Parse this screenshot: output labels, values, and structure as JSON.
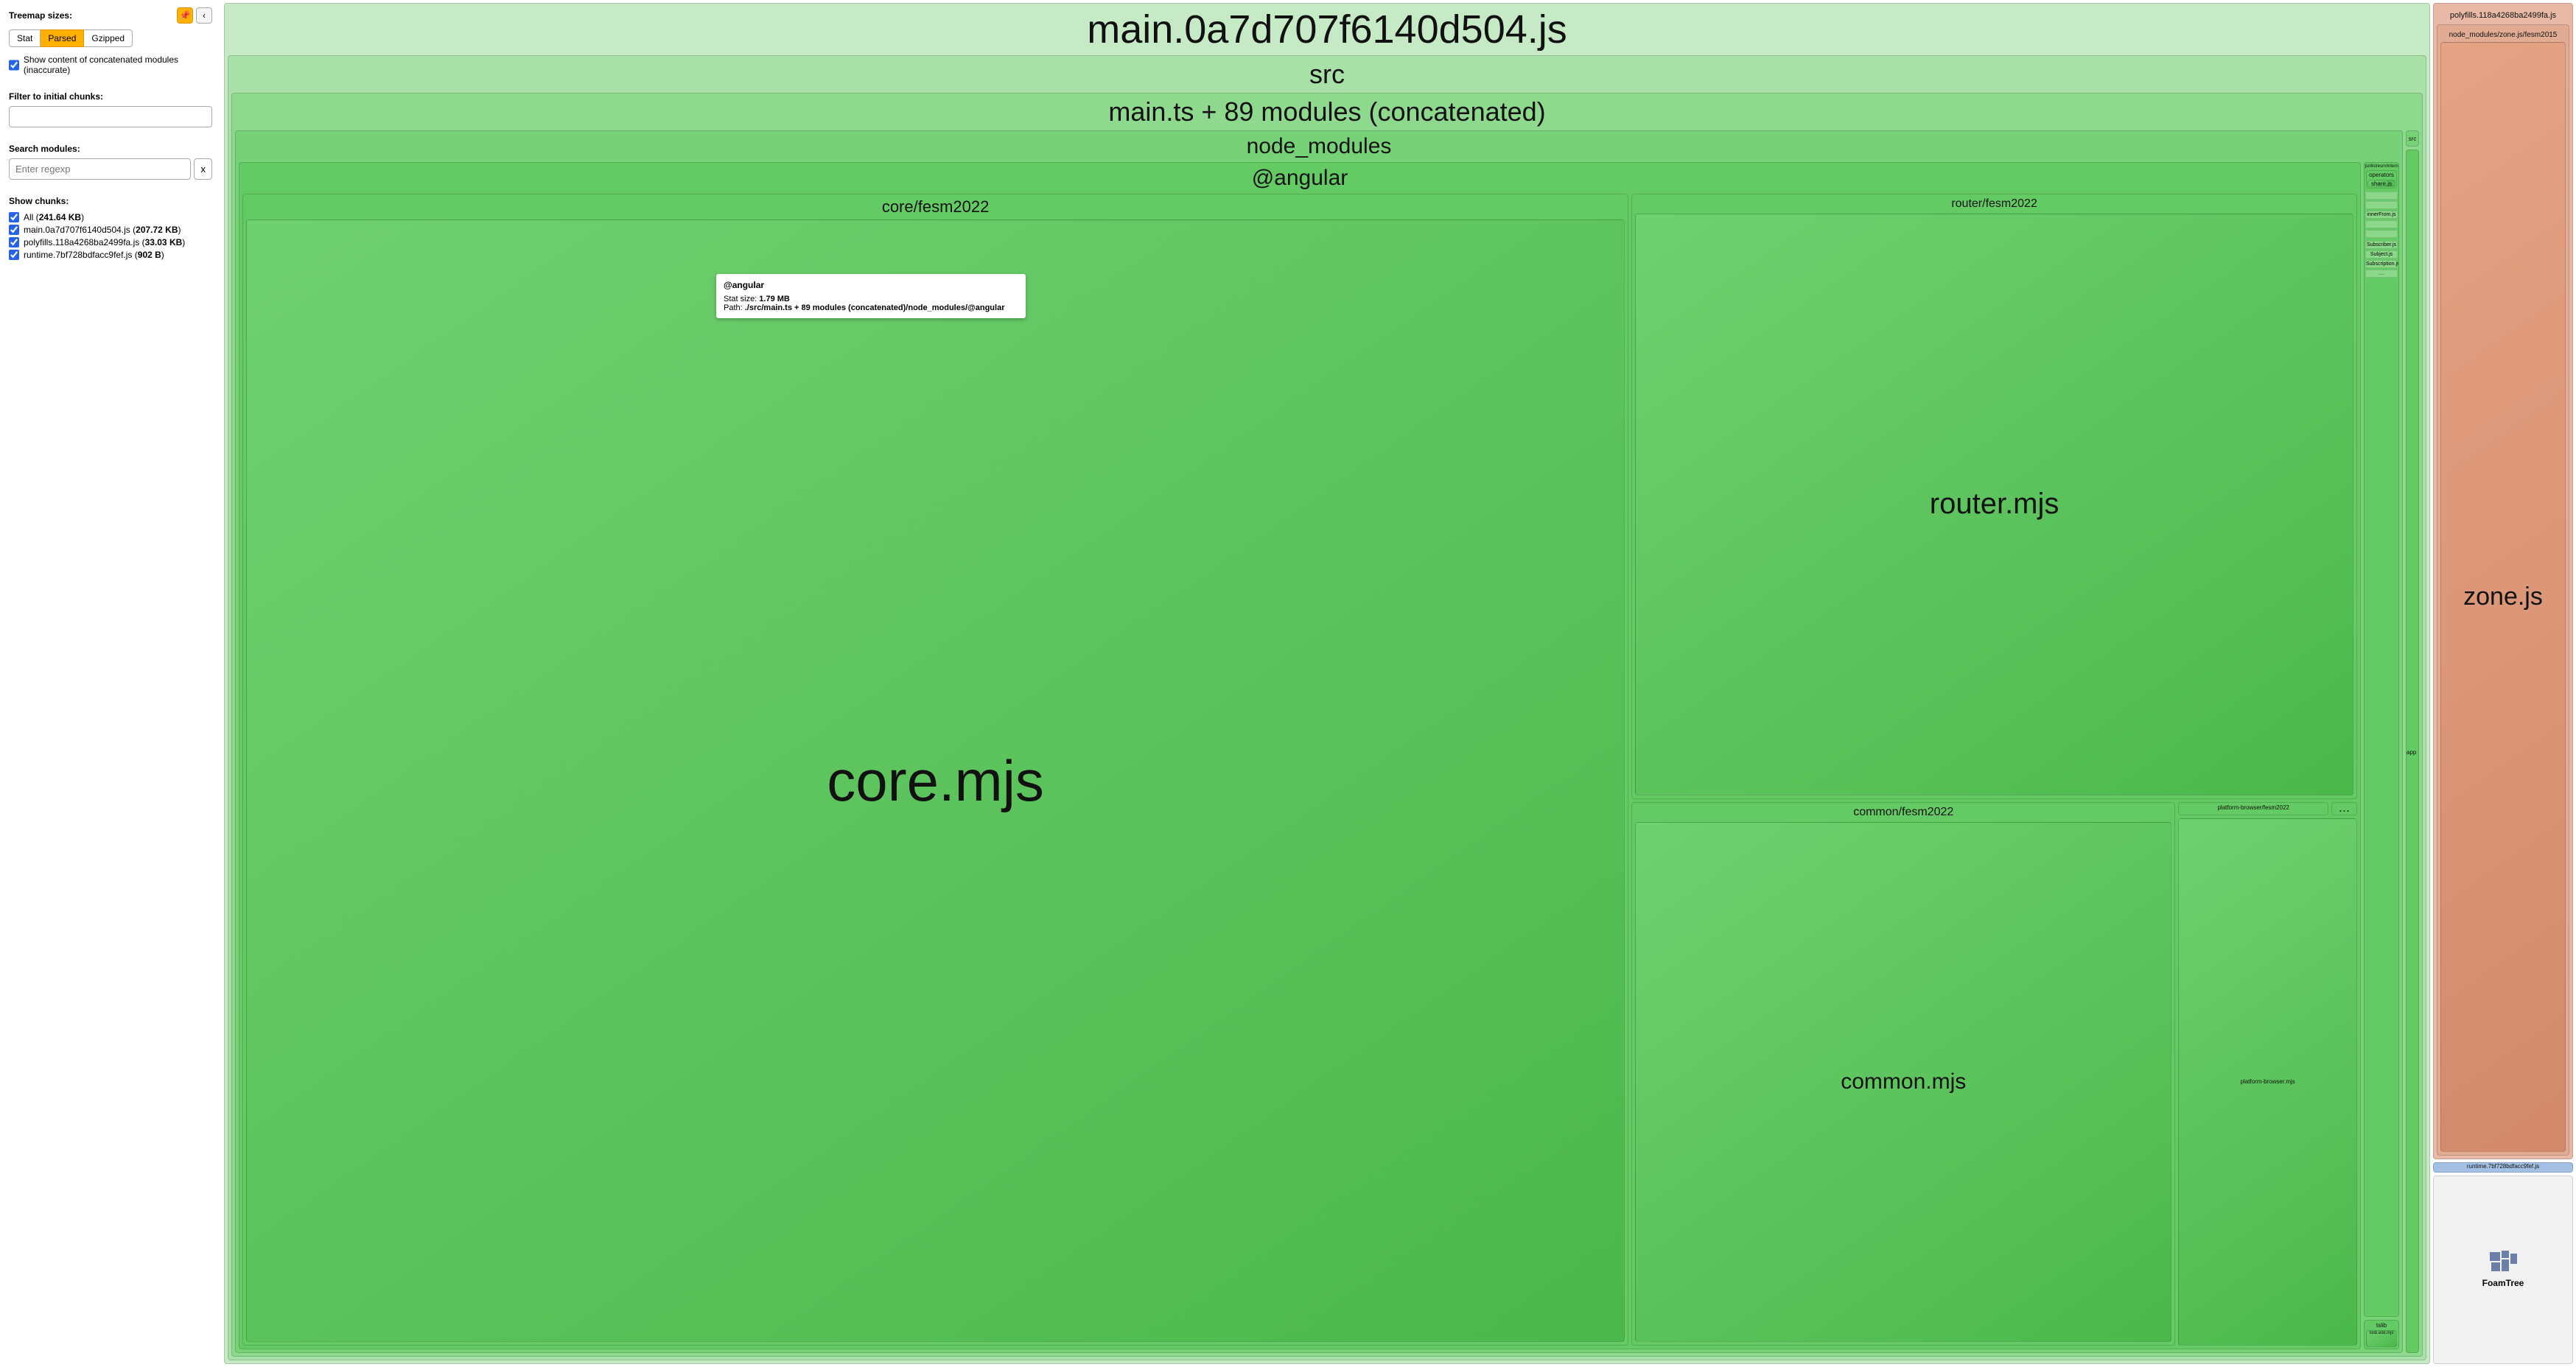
{
  "sidebar": {
    "sizes_label": "Treemap sizes:",
    "pin_glyph": "📌",
    "collapse_glyph": "‹",
    "size_buttons": {
      "stat": "Stat",
      "parsed": "Parsed",
      "gzipped": "Gzipped"
    },
    "concat_checkbox_label": "Show content of concatenated modules (inaccurate)",
    "filter_label": "Filter to initial chunks:",
    "search_label": "Search modules:",
    "search_placeholder": "Enter regexp",
    "search_clear": "x",
    "show_chunks_label": "Show chunks:",
    "chunks": [
      {
        "name": "All",
        "size": "241.64 KB"
      },
      {
        "name": "main.0a7d707f6140d504.js",
        "size": "207.72 KB"
      },
      {
        "name": "polyfills.118a4268ba2499fa.js",
        "size": "33.03 KB"
      },
      {
        "name": "runtime.7bf728bdfacc9fef.js",
        "size": "902 B"
      }
    ]
  },
  "treemap": {
    "main": {
      "title": "main.0a7d707f6140d504.js",
      "src_label": "src",
      "concat_label": "main.ts + 89 modules (concatenated)",
      "node_modules_label": "node_modules",
      "angular_label": "@angular",
      "core_fesm_label": "core/fesm2022",
      "core_mjs_label": "core.mjs",
      "router_fesm_label": "router/fesm2022",
      "router_mjs_label": "router.mjs",
      "common_fesm_label": "common/fesm2022",
      "common_mjs_label": "common.mjs",
      "platform_browser_fesm_label": "platform-browser/fesm2022",
      "platform_browser_mjs_label": "platform-browser.mjs",
      "ellipsis": "…",
      "src_side_label": "src",
      "app_label": "app",
      "rxjs_internal_label": "rxjs/dist/esm/internal",
      "operators_label": "operators",
      "share_label": "share.js",
      "innerfrom_label": "innerFrom.js",
      "subscriber_label": "Subscriber.js",
      "subject_label": "Subject.js",
      "subscription_label": "Subscription.js",
      "tslib_label": "tslib",
      "tslib_mjs_label": "tslib.es6.mjs"
    },
    "polyfills": {
      "title": "polyfills.118a4268ba2499fa.js",
      "path_label": "node_modules/zone.js/fesm2015",
      "zone_label": "zone.js"
    },
    "runtime_label": "runtime.7bf728bdfacc9fef.js",
    "foamtree_label": "FoamTree"
  },
  "tooltip": {
    "title": "@angular",
    "stat_label": "Stat size: ",
    "stat_value": "1.79 MB",
    "path_label": "Path: ",
    "path_value": "./src/main.ts + 89 modules (concatenated)/node_modules/@angular"
  }
}
